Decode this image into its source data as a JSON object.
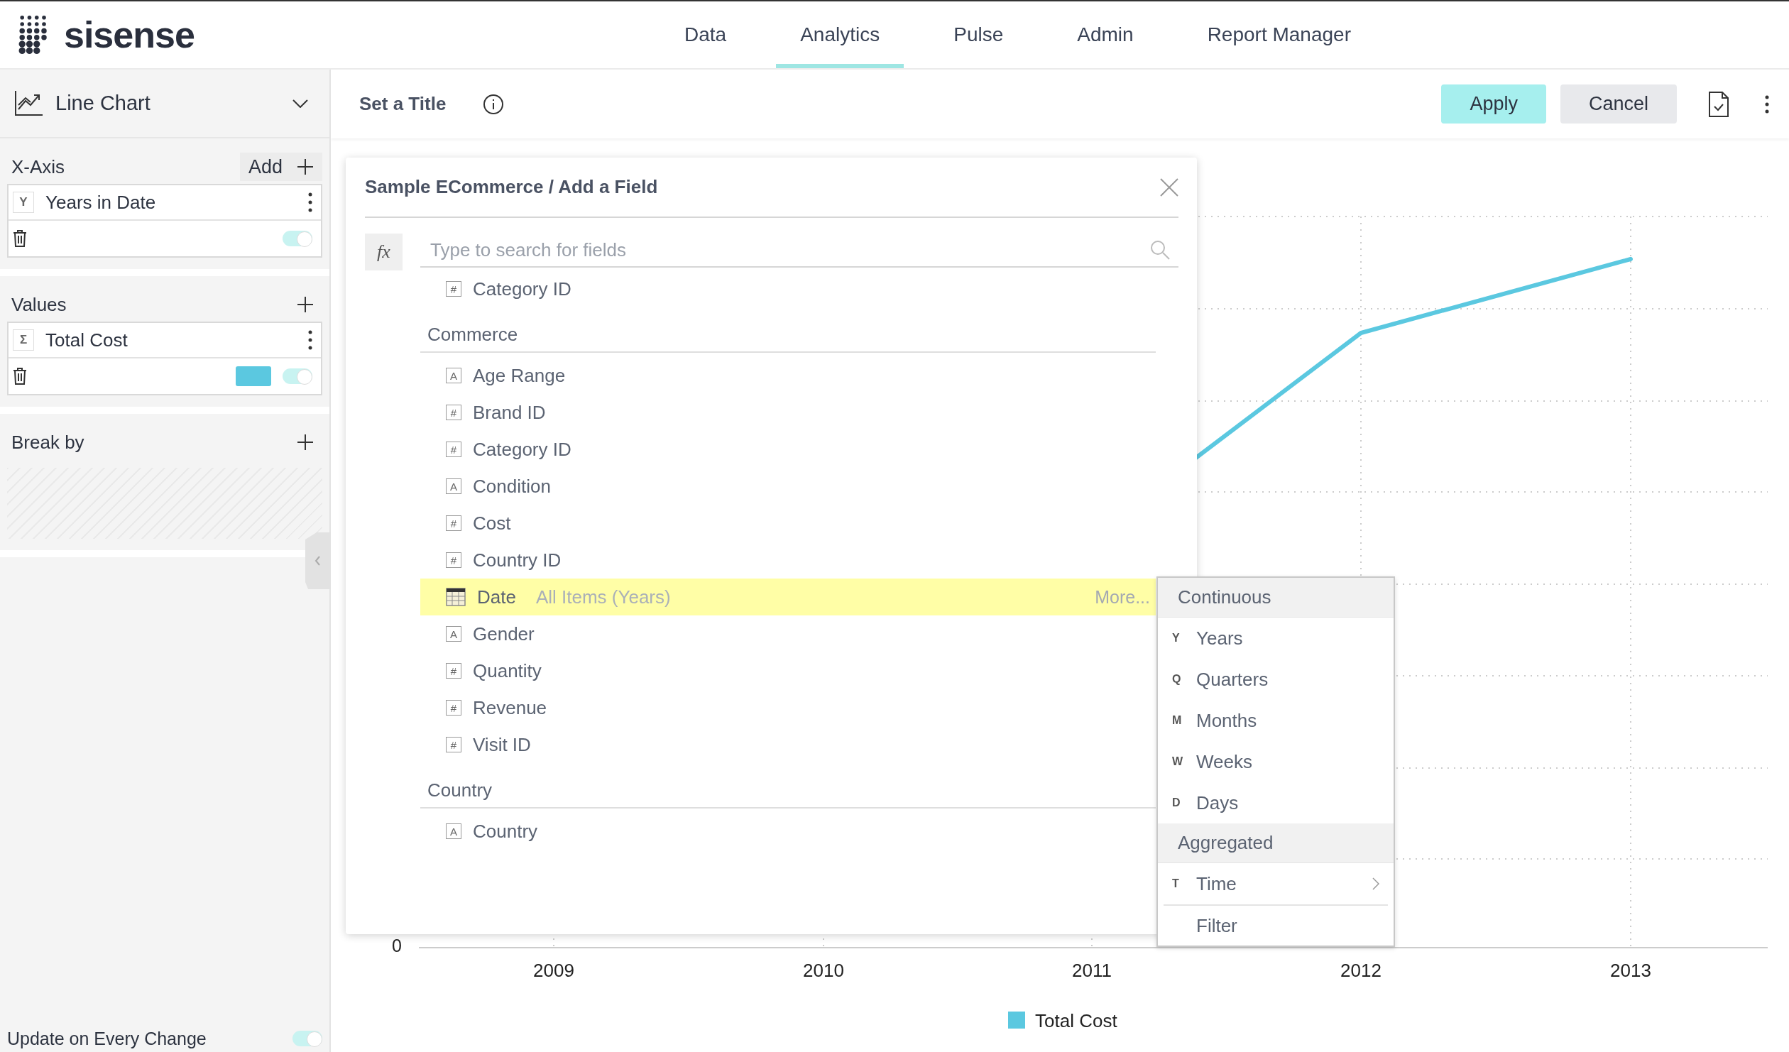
{
  "header": {
    "logo": "sisense",
    "nav": [
      {
        "label": "Data",
        "selected": false
      },
      {
        "label": "Analytics",
        "selected": true
      },
      {
        "label": "Pulse",
        "selected": false
      },
      {
        "label": "Admin",
        "selected": false
      },
      {
        "label": "Report Manager",
        "selected": false
      }
    ]
  },
  "sidebar": {
    "widget_type": "Line Chart",
    "sections": [
      {
        "title": "X-Axis",
        "add_label": "Add",
        "items": [
          {
            "badge": "Y",
            "label": "Years in Date",
            "on": true
          }
        ]
      },
      {
        "title": "Values",
        "items": [
          {
            "badge": "Σ",
            "label": "Total Cost",
            "color": "#5bc8e0",
            "on": true
          }
        ]
      },
      {
        "title": "Break by"
      }
    ],
    "update_label": "Update on Every Change",
    "update_on": true
  },
  "toolbar": {
    "title": "Set a Title",
    "apply": "Apply",
    "cancel": "Cancel"
  },
  "chart": {
    "zero_label": "0",
    "x_labels": [
      "2009",
      "2010",
      "2011",
      "2012",
      "2013"
    ],
    "legend": {
      "label": "Total Cost",
      "color": "#5bc8e0"
    }
  },
  "dialog": {
    "title": "Sample ECommerce / Add a Field",
    "fx": "fx",
    "search_placeholder": "Type to search for fields",
    "rows": [
      {
        "kind": "field",
        "glyph": "#",
        "label": "Category ID",
        "selected": false
      },
      {
        "kind": "section",
        "label": "Commerce"
      },
      {
        "kind": "field",
        "glyph": "A",
        "label": "Age Range",
        "selected": false
      },
      {
        "kind": "field",
        "glyph": "#",
        "label": "Brand ID",
        "selected": false
      },
      {
        "kind": "field",
        "glyph": "#",
        "label": "Category ID",
        "selected": false
      },
      {
        "kind": "field",
        "glyph": "A",
        "label": "Condition",
        "selected": false
      },
      {
        "kind": "field",
        "glyph": "#",
        "label": "Cost",
        "selected": false
      },
      {
        "kind": "field",
        "glyph": "#",
        "label": "Country ID",
        "selected": false
      },
      {
        "kind": "date",
        "label": "Date",
        "detail": "All Items (Years)",
        "more": "More...",
        "selected": true
      },
      {
        "kind": "field",
        "glyph": "A",
        "label": "Gender",
        "selected": false
      },
      {
        "kind": "field",
        "glyph": "#",
        "label": "Quantity",
        "selected": false
      },
      {
        "kind": "field",
        "glyph": "#",
        "label": "Revenue",
        "selected": false
      },
      {
        "kind": "field",
        "glyph": "#",
        "label": "Visit ID",
        "selected": false
      },
      {
        "kind": "section",
        "label": "Country"
      },
      {
        "kind": "field",
        "glyph": "A",
        "label": "Country",
        "selected": false
      }
    ]
  },
  "menu": {
    "items": [
      {
        "kind": "header",
        "label": "Continuous"
      },
      {
        "kind": "option",
        "key": "Y",
        "label": "Years"
      },
      {
        "kind": "option",
        "key": "Q",
        "label": "Quarters"
      },
      {
        "kind": "option",
        "key": "M",
        "label": "Months"
      },
      {
        "kind": "option",
        "key": "W",
        "label": "Weeks"
      },
      {
        "kind": "option",
        "key": "D",
        "label": "Days"
      },
      {
        "kind": "header",
        "label": "Aggregated"
      },
      {
        "kind": "submenu",
        "key": "T",
        "label": "Time"
      },
      {
        "kind": "plain",
        "label": "Filter"
      }
    ]
  }
}
